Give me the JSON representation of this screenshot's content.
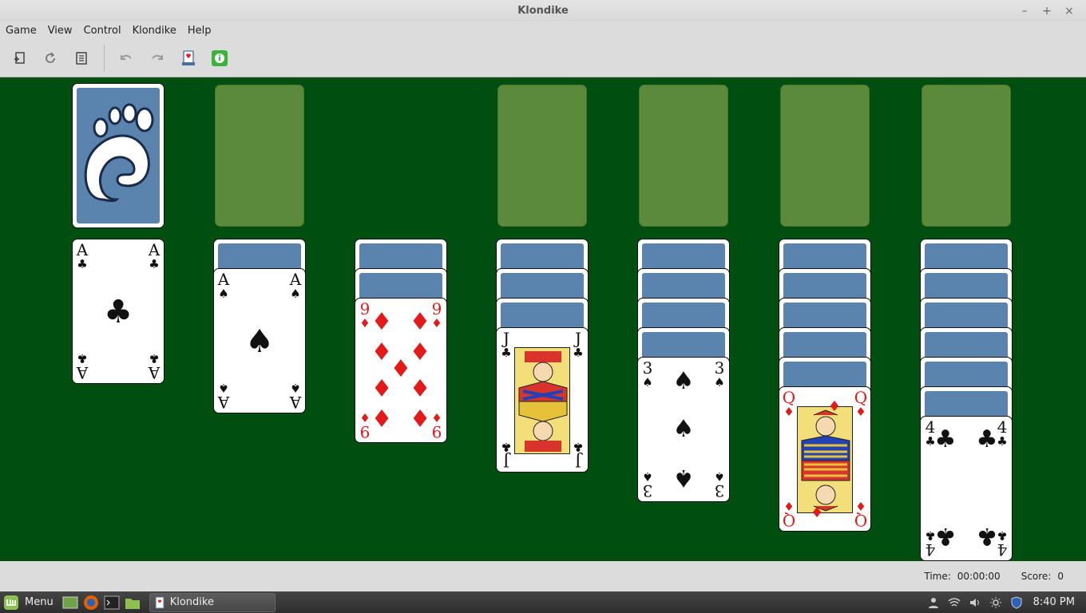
{
  "window": {
    "title": "Klondike"
  },
  "window_controls": {
    "minimize": "–",
    "maximize": "+",
    "close": "×"
  },
  "menubar": [
    "Game",
    "View",
    "Control",
    "Klondike",
    "Help"
  ],
  "toolbar": {
    "buttons": [
      "new-game-icon",
      "restart-icon",
      "hint-list-icon",
      "undo-icon",
      "redo-icon",
      "deal-icon",
      "info-icon"
    ]
  },
  "stock": {
    "state": "face-down"
  },
  "foundations": {
    "count": 4,
    "state": "empty"
  },
  "tableau": [
    {
      "hidden": 0,
      "face_up": [
        {
          "rank": "A",
          "suit": "♣",
          "color": "black"
        }
      ]
    },
    {
      "hidden": 1,
      "face_up": [
        {
          "rank": "A",
          "suit": "♠",
          "color": "black"
        }
      ]
    },
    {
      "hidden": 2,
      "face_up": [
        {
          "rank": "9",
          "suit": "♦",
          "color": "red"
        }
      ]
    },
    {
      "hidden": 3,
      "face_up": [
        {
          "rank": "J",
          "suit": "♣",
          "color": "black"
        }
      ]
    },
    {
      "hidden": 4,
      "face_up": [
        {
          "rank": "3",
          "suit": "♠",
          "color": "black"
        }
      ]
    },
    {
      "hidden": 5,
      "face_up": [
        {
          "rank": "Q",
          "suit": "♦",
          "color": "red"
        }
      ]
    },
    {
      "hidden": 6,
      "face_up": [
        {
          "rank": "4",
          "suit": "♣",
          "color": "black"
        }
      ]
    }
  ],
  "status": {
    "time_label": "Time:",
    "time_value": "00:00:00",
    "score_label": "Score:",
    "score_value": "0"
  },
  "panel": {
    "menu_label": "Menu",
    "task_label": "Klondike",
    "clock": "8:40 PM"
  },
  "colors": {
    "felt": "#004f10",
    "slot": "#5b8a3a",
    "card_back": "#5a84ad",
    "red_suit": "#e21a1a"
  }
}
